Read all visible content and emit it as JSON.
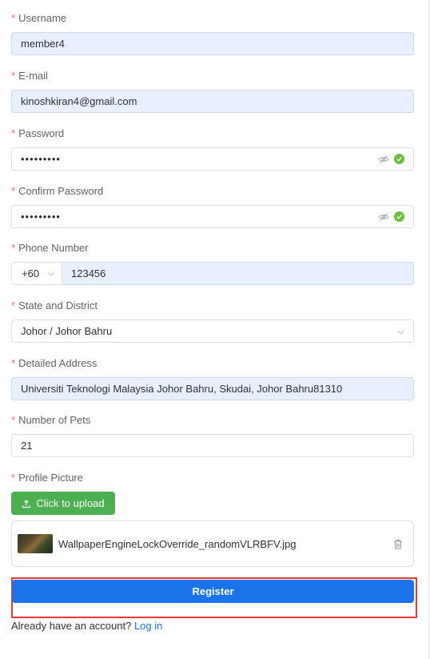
{
  "form": {
    "username": {
      "label": "Username",
      "value": "member4"
    },
    "email": {
      "label": "E-mail",
      "value": "kinoshkiran4@gmail.com"
    },
    "password": {
      "label": "Password",
      "value": "•••••••••"
    },
    "confirm_password": {
      "label": "Confirm Password",
      "value": "•••••••••"
    },
    "phone": {
      "label": "Phone Number",
      "prefix": "+60",
      "value": "123456"
    },
    "state_district": {
      "label": "State and District",
      "value": "Johor / Johor Bahru"
    },
    "address": {
      "label": "Detailed Address",
      "value": "Universiti Teknologi Malaysia Johor Bahru, Skudai, Johor Bahru81310"
    },
    "pets": {
      "label": "Number of Pets",
      "value": "21"
    },
    "profile_picture": {
      "label": "Profile Picture",
      "upload_label": "Click to upload",
      "file_name": "WallpaperEngineLockOverride_randomVLRBFV.jpg"
    },
    "required_mark": "*"
  },
  "actions": {
    "register_label": "Register",
    "login_prompt": "Already have an account?",
    "login_link": "Log in"
  },
  "colors": {
    "accent": "#1a73e8",
    "success": "#67c23a",
    "upload": "#4caf50",
    "required": "#f56c6c",
    "highlight": "#e53935"
  },
  "icons": {
    "eye": "eye-off-icon",
    "check": "check-circle-icon",
    "chevron": "chevron-down-icon",
    "upload": "upload-icon",
    "trash": "trash-icon"
  }
}
